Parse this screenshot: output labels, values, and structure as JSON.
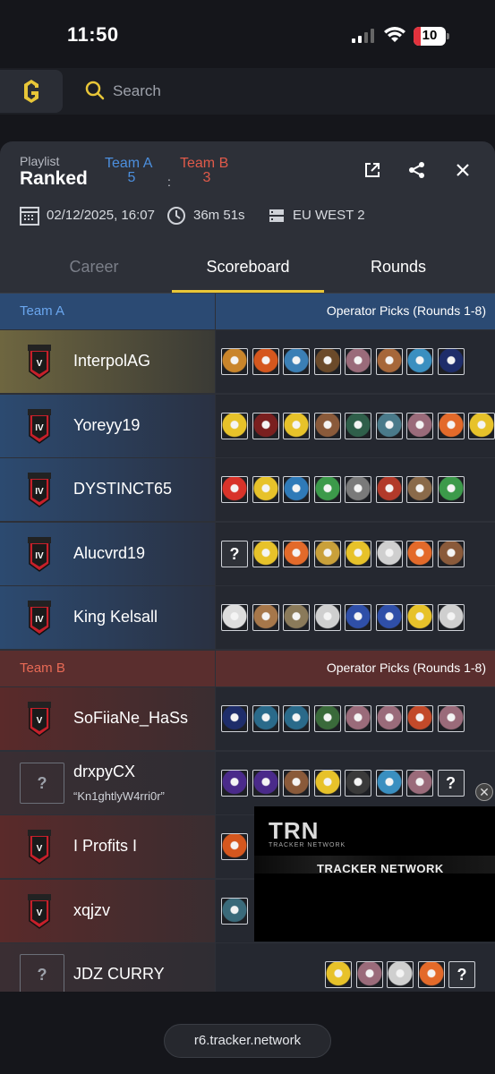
{
  "status_bar": {
    "time": "11:50",
    "battery": "10"
  },
  "header": {
    "search_placeholder": "Search"
  },
  "match": {
    "playlist_label": "Playlist",
    "playlist_value": "Ranked",
    "team_a_name": "Team A",
    "team_a_score": "5",
    "team_b_name": "Team B",
    "team_b_score": "3",
    "score_separator": ":",
    "datetime": "02/12/2025, 16:07",
    "duration": "36m 51s",
    "server": "EU WEST 2"
  },
  "tabs": [
    "Career",
    "Scoreboard",
    "Rounds"
  ],
  "teams": [
    {
      "name": "Team A",
      "ops_header": "Operator Picks (Rounds 1-8)",
      "players": [
        {
          "name": "InterpolAG",
          "nick": "",
          "rank": "V",
          "icons": [
            "#c9852b",
            "#d5571e",
            "#3b7fb5",
            "#6b4a2a",
            "#9a6b7a",
            "#a6673a",
            "#3a8fc0",
            "#1e2d6a"
          ]
        },
        {
          "name": "Yoreyy19",
          "nick": "",
          "rank": "IV",
          "icons": [
            "#e7c22a",
            "#7a1f1f",
            "#e7c22a",
            "#8a5a3a",
            "#2f5f4a",
            "#4a7a8a",
            "#9a6b7a",
            "#e36a2a",
            "#e7c22a"
          ]
        },
        {
          "name": "DYSTINCT65",
          "nick": "",
          "rank": "IV",
          "icons": [
            "#d8332a",
            "#e7c22a",
            "#2f7ab8",
            "#3c9a4a",
            "#7a7a7a",
            "#b23a2a",
            "#8a6a4a",
            "#3c9a4a"
          ]
        },
        {
          "name": "Alucvrd19",
          "nick": "",
          "rank": "IV",
          "icons": [
            "#2e3138",
            "#e7c22a",
            "#e36a2a",
            "#c9a03a",
            "#e7c22a",
            "#cfcfcf",
            "#e36a2a",
            "#8a5a3a"
          ]
        },
        {
          "name": "King Kelsall",
          "nick": "",
          "rank": "IV",
          "icons": [
            "#dddddd",
            "#a6774a",
            "#8a7a5a",
            "#cfcfcf",
            "#2f4fa8",
            "#2f4fa8",
            "#e7c22a",
            "#cfcfcf"
          ]
        }
      ]
    },
    {
      "name": "Team B",
      "ops_header": "Operator Picks (Rounds 1-8)",
      "players": [
        {
          "name": "SoFiiaNe_HaSs",
          "nick": "",
          "rank": "V",
          "icons": [
            "#1e2d6a",
            "#2a6a8a",
            "#2a6a8a",
            "#3a6a3a",
            "#9a6b7a",
            "#9a6b7a",
            "#c24a2a",
            "#9a6b7a"
          ]
        },
        {
          "name": "drxpyCX",
          "nick": "“Kn1ghtlyW4rri0r”",
          "rank": "?",
          "icons": [
            "#4a2a8a",
            "#4a2a8a",
            "#8a5a3a",
            "#e7c22a",
            "#3a3a3a",
            "#3a8fc0",
            "#9a6b7a",
            "#2e3138"
          ]
        },
        {
          "name": "I Profits I",
          "nick": "",
          "rank": "V",
          "icons": [
            "#d5571e"
          ]
        },
        {
          "name": "xqjzv",
          "nick": "",
          "rank": "V",
          "icons": [
            "#3a6a7a"
          ]
        },
        {
          "name": "JDZ CURRY",
          "nick": "",
          "rank": "?",
          "icons": [
            "#e7c22a",
            "#9a6b7a",
            "#cfcfcf",
            "#e36a2a",
            "#2e3138"
          ]
        }
      ]
    }
  ],
  "ad": {
    "logo": "TRN",
    "logo_sub": "TRACKER NETWORK",
    "title": "TRACKER NETWORK"
  },
  "footer": {
    "url": "r6.tracker.network"
  }
}
